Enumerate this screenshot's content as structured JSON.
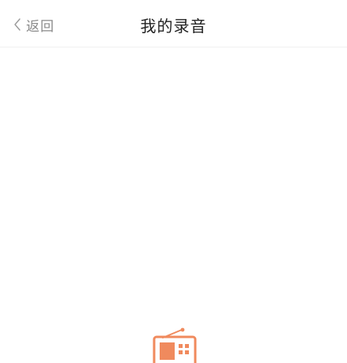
{
  "nav": {
    "back_label": "返回",
    "title": "我的录音"
  },
  "icons": {
    "back": "chevron-left-icon",
    "empty_state": "radio-icon"
  },
  "colors": {
    "accent": "#f08a5d",
    "title_text": "#222222",
    "back_text": "#8a8a8a",
    "divider": "#f1f1f1"
  }
}
